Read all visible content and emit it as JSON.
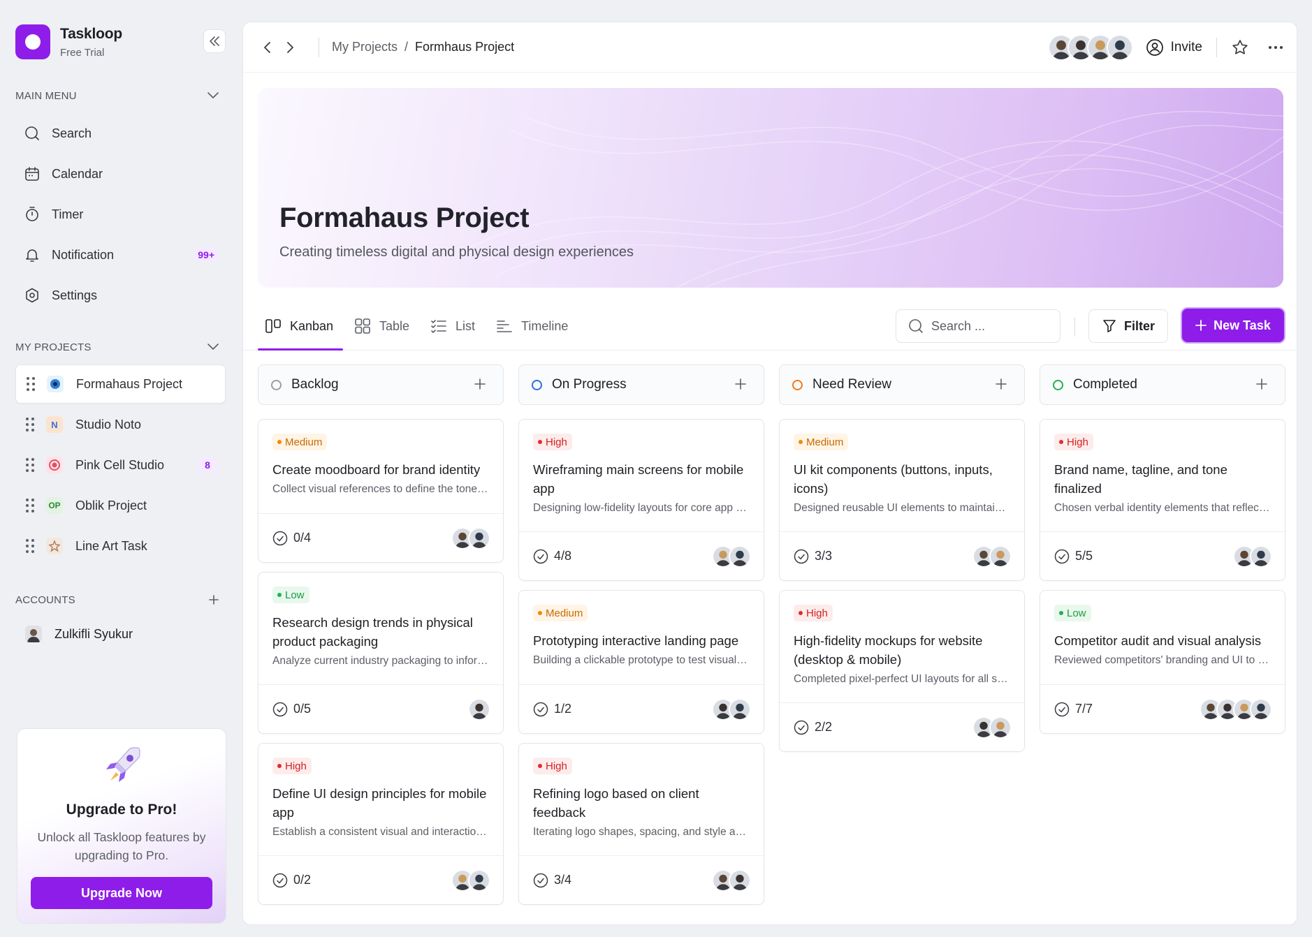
{
  "app": {
    "name": "Taskloop",
    "plan": "Free Trial"
  },
  "sidebar": {
    "main_menu_label": "MAIN MENU",
    "items": [
      {
        "label": "Search",
        "icon": "search-icon"
      },
      {
        "label": "Calendar",
        "icon": "calendar-icon"
      },
      {
        "label": "Timer",
        "icon": "timer-icon"
      },
      {
        "label": "Notification",
        "icon": "bell-icon",
        "badge": "99+"
      },
      {
        "label": "Settings",
        "icon": "settings-icon"
      }
    ],
    "projects_label": "MY PROJECTS",
    "projects": [
      {
        "label": "Formahaus Project",
        "icon_color": "#2b7fd6",
        "active": true
      },
      {
        "label": "Studio Noto",
        "icon_text": "N",
        "icon_color": "#3a6fe0"
      },
      {
        "label": "Pink Cell Studio",
        "icon_color": "#e24f6a",
        "badge": "8"
      },
      {
        "label": "Oblik Project",
        "icon_text": "OP",
        "icon_color": "#2f8a3a"
      },
      {
        "label": "Line Art Task",
        "icon_color": "#b07a56"
      }
    ],
    "accounts_label": "ACCOUNTS",
    "account": {
      "name": "Zulkifli Syukur"
    },
    "upgrade": {
      "title": "Upgrade to Pro!",
      "text": "Unlock all Taskloop features by upgrading to Pro.",
      "button": "Upgrade Now"
    }
  },
  "topbar": {
    "breadcrumb_parent": "My Projects",
    "breadcrumb_separator": "/",
    "breadcrumb_current": "Formhaus Project",
    "invite_label": "Invite"
  },
  "banner": {
    "title": "Formahaus Project",
    "subtitle": "Creating timeless digital and physical design experiences"
  },
  "views": {
    "tabs": [
      {
        "label": "Kanban",
        "icon": "kanban-icon",
        "active": true
      },
      {
        "label": "Table",
        "icon": "table-icon"
      },
      {
        "label": "List",
        "icon": "list-icon"
      },
      {
        "label": "Timeline",
        "icon": "timeline-icon"
      }
    ],
    "search_placeholder": "Search ...",
    "filter_label": "Filter",
    "new_task_label": "New Task"
  },
  "columns": [
    {
      "title": "Backlog",
      "color": "#9aa0a8",
      "cards": [
        {
          "priority": "Medium",
          "level": "medium",
          "title": "Create moodboard for brand identity",
          "desc": "Collect visual references to define the tone and mood of the brand",
          "progress": "0/4",
          "avatars": [
            "#5b4636",
            "#2f3a4a"
          ]
        },
        {
          "priority": "Low",
          "level": "low",
          "title": "Research design trends in physical product packaging",
          "desc": "Analyze current industry packaging to inform direction",
          "progress": "0/5",
          "avatars": [
            "#3a3230"
          ]
        },
        {
          "priority": "High",
          "level": "high",
          "title": "Define UI design principles for mobile app",
          "desc": "Establish a consistent visual and interaction language",
          "progress": "0/2",
          "avatars": [
            "#c99a5b",
            "#2f3a4a"
          ]
        }
      ]
    },
    {
      "title": "On Progress",
      "color": "#2b6fe0",
      "cards": [
        {
          "priority": "High",
          "level": "high",
          "title": "Wireframing main screens for mobile app",
          "desc": "Designing low-fidelity layouts for core app screens",
          "progress": "4/8",
          "avatars": [
            "#c99a5b",
            "#2f3a4a"
          ]
        },
        {
          "priority": "Medium",
          "level": "medium",
          "title": "Prototyping interactive landing page",
          "desc": "Building a clickable prototype to test visual flow",
          "progress": "1/2",
          "avatars": [
            "#3a3230",
            "#2f3a4a"
          ]
        },
        {
          "priority": "High",
          "level": "high",
          "title": "Refining logo based on client feedback",
          "desc": "Iterating logo shapes, spacing, and style accordingly",
          "progress": "3/4",
          "avatars": [
            "#5b4636",
            "#3a3230"
          ]
        }
      ]
    },
    {
      "title": "Need Review",
      "color": "#f07a1a",
      "cards": [
        {
          "priority": "Medium",
          "level": "medium",
          "title": "UI kit components (buttons, inputs, icons)",
          "desc": "Designed reusable UI elements to maintain consistency",
          "progress": "3/3",
          "avatars": [
            "#5b4636",
            "#c99a5b"
          ]
        },
        {
          "priority": "High",
          "level": "high",
          "title": "High-fidelity mockups for website (desktop & mobile)",
          "desc": "Completed pixel-perfect UI layouts for all screens",
          "progress": "2/2",
          "avatars": [
            "#3a3230",
            "#c99a5b"
          ]
        }
      ]
    },
    {
      "title": "Completed",
      "color": "#22b14c",
      "cards": [
        {
          "priority": "High",
          "level": "high",
          "title": "Brand name, tagline, and tone finalized",
          "desc": "Chosen verbal identity elements that reflect the brand",
          "progress": "5/5",
          "avatars": [
            "#5b4636",
            "#2f3a4a"
          ]
        },
        {
          "priority": "Low",
          "level": "low",
          "title": "Competitor audit and visual analysis",
          "desc": "Reviewed competitors' branding and UI to find gaps",
          "progress": "7/7",
          "avatars": [
            "#5b4636",
            "#3a3230",
            "#c99a5b",
            "#2f3a4a"
          ]
        }
      ]
    }
  ],
  "team_avatars": [
    "#5b4636",
    "#3a3230",
    "#c99a5b",
    "#2f3a4a"
  ],
  "colors": {
    "accent": "#8f1de9"
  }
}
